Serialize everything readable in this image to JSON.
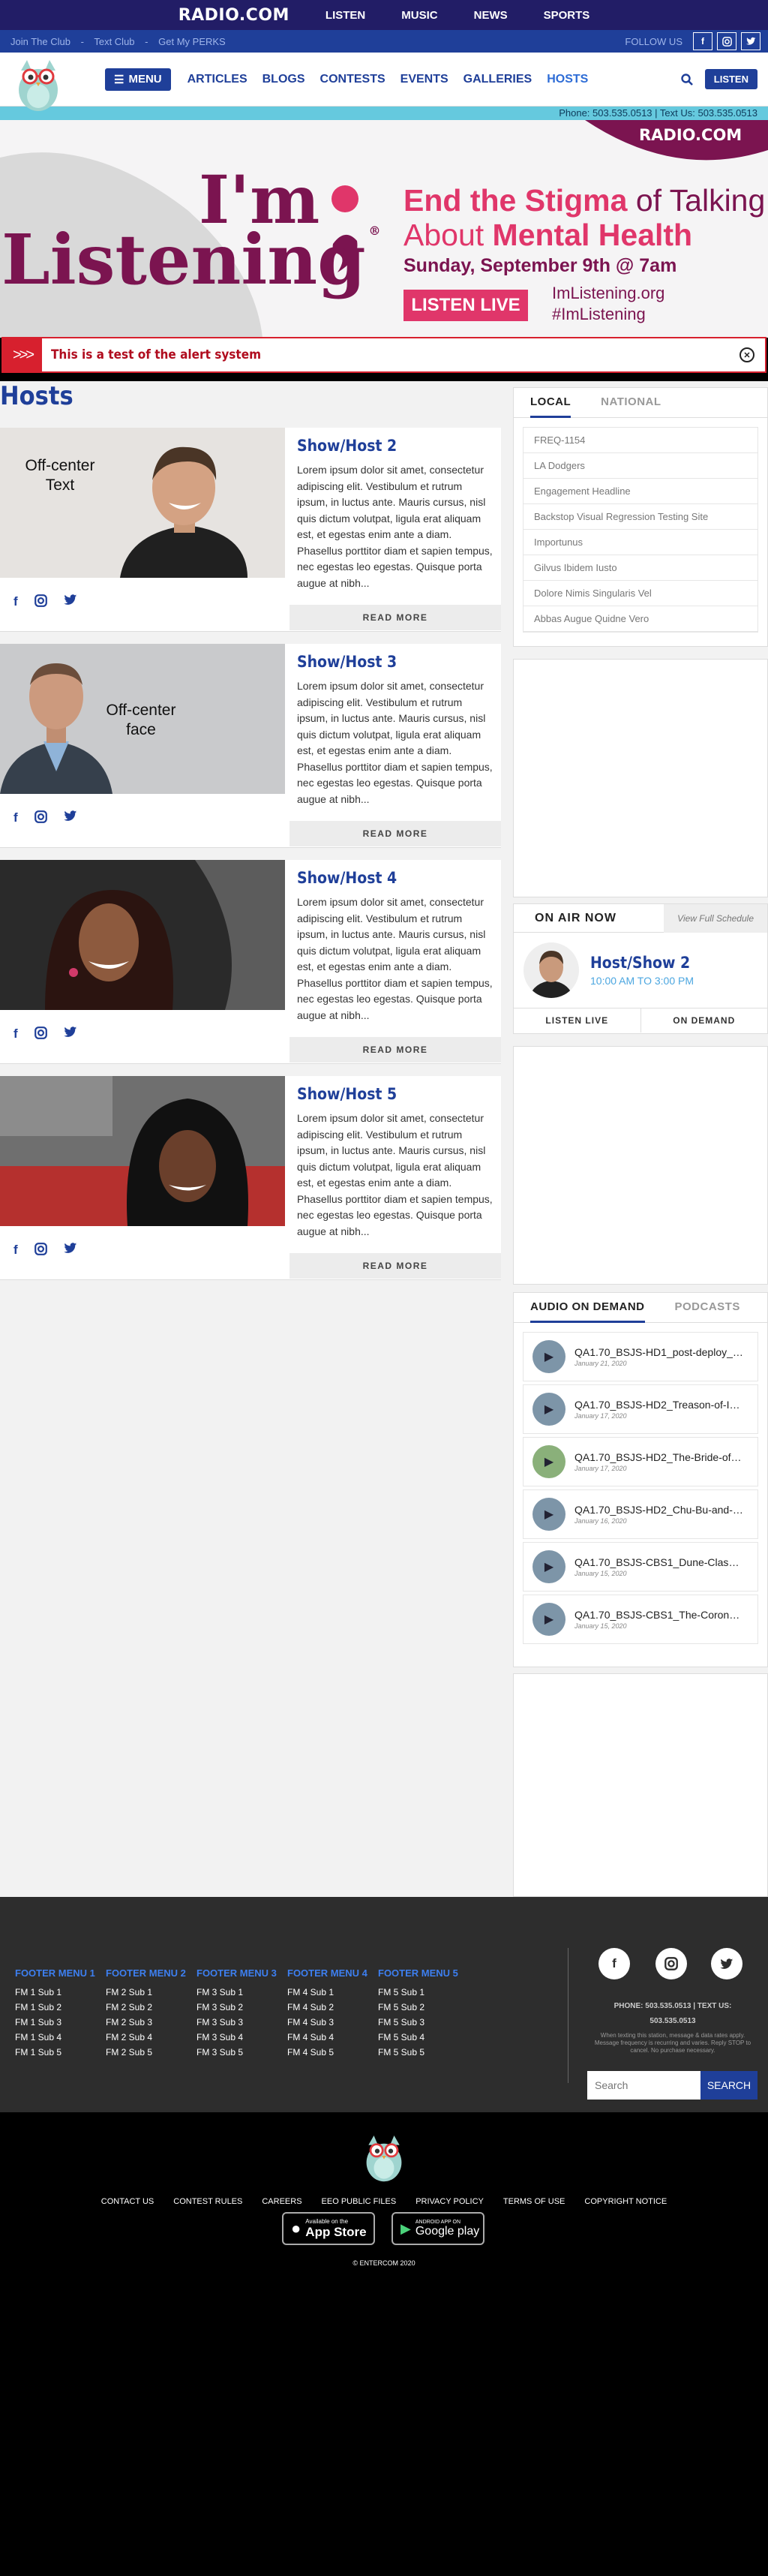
{
  "topbar": {
    "logo": "RADIO.COM",
    "nav": [
      "LISTEN",
      "MUSIC",
      "NEWS",
      "SPORTS"
    ]
  },
  "clubbar": {
    "links": [
      "Join The Club",
      "Text Club",
      "Get My PERKS"
    ],
    "separator": "-",
    "follow": "FOLLOW US"
  },
  "navbar": {
    "menu": "MENU",
    "links": [
      "ARTICLES",
      "BLOGS",
      "CONTESTS",
      "EVENTS",
      "GALLERIES",
      "HOSTS"
    ],
    "listen": "LISTEN"
  },
  "phonebar": {
    "text": "Phone: 503.535.0513 | Text Us: 503.535.0513"
  },
  "banner": {
    "logo": "RADIO.COM",
    "im": "I'm",
    "listening": "Listening",
    "reg": "®",
    "line1a": "End the Stigma",
    "line1b": " of Talking",
    "line2a": "About ",
    "line2b": "Mental Health",
    "date": "Sunday, September 9th @ 7am",
    "cta": "LISTEN LIVE",
    "url": "ImListening.org",
    "hashtag": "#ImListening"
  },
  "alert": {
    "text": "This is a test of the alert system",
    "arrows": ">>>"
  },
  "hosts": {
    "title": "Hosts",
    "read_more": "READ MORE",
    "items": [
      {
        "name": "Show/Host 2",
        "img_text": "Off-center Text",
        "desc": "Lorem ipsum dolor sit amet, consectetur adipiscing elit. Vestibulum et rutrum ipsum, in luctus ante. Mauris cursus, nisl quis dictum volutpat, ligula erat aliquam est, et egestas enim ante a diam. Phasellus porttitor diam et sapien tempus, nec egestas leo egestas. Quisque porta augue at nibh..."
      },
      {
        "name": "Show/Host 3",
        "img_text": "Off-center face",
        "desc": "Lorem ipsum dolor sit amet, consectetur adipiscing elit. Vestibulum et rutrum ipsum, in luctus ante. Mauris cursus, nisl quis dictum volutpat, ligula erat aliquam est, et egestas enim ante a diam. Phasellus porttitor diam et sapien tempus, nec egestas leo egestas. Quisque porta augue at nibh..."
      },
      {
        "name": "Show/Host 4",
        "img_text": "",
        "desc": "Lorem ipsum dolor sit amet, consectetur adipiscing elit. Vestibulum et rutrum ipsum, in luctus ante. Mauris cursus, nisl quis dictum volutpat, ligula erat aliquam est, et egestas enim ante a diam. Phasellus porttitor diam et sapien tempus, nec egestas leo egestas. Quisque porta augue at nibh..."
      },
      {
        "name": "Show/Host 5",
        "img_text": "",
        "desc": "Lorem ipsum dolor sit amet, consectetur adipiscing elit. Vestibulum et rutrum ipsum, in luctus ante. Mauris cursus, nisl quis dictum volutpat, ligula erat aliquam est, et egestas enim ante a diam. Phasellus porttitor diam et sapien tempus, nec egestas leo egestas. Quisque porta augue at nibh..."
      }
    ]
  },
  "localtabs": {
    "tabs": [
      "LOCAL",
      "NATIONAL"
    ],
    "items": [
      "FREQ-1154",
      "LA Dodgers",
      "Engagement Headline",
      "Backstop Visual Regression Testing Site",
      "Importunus",
      "Gilvus Ibidem Iusto",
      "Dolore Nimis Singularis Vel",
      "Abbas Augue Quidne Vero"
    ]
  },
  "onair": {
    "title": "ON AIR NOW",
    "schedule": "View Full Schedule",
    "show": "Host/Show 2",
    "time": "10:00 AM TO 3:00 PM",
    "listen_live": "LISTEN LIVE",
    "on_demand": "ON DEMAND"
  },
  "audio": {
    "tabs": [
      "AUDIO ON DEMAND",
      "PODCASTS"
    ],
    "items": [
      {
        "title": "QA1.70_BSJS-HD1_post-deploy_T...",
        "date": "January 21, 2020"
      },
      {
        "title": "QA1.70_BSJS-HD2_Treason-of-Ise...",
        "date": "January 17, 2020"
      },
      {
        "title": "QA1.70_BSJS-HD2_The-Bride-of-th...",
        "date": "January 17, 2020"
      },
      {
        "title": "QA1.70_BSJS-HD2_Chu-Bu-and-Sh...",
        "date": "January 16, 2020"
      },
      {
        "title": "QA1.70_BSJS-CBS1_Dune-Class-1-...",
        "date": "January 15, 2020"
      },
      {
        "title": "QA1.70_BSJS-CBS1_The-Coronati...",
        "date": "January 15, 2020"
      }
    ]
  },
  "footer": {
    "menus": [
      {
        "title": "FOOTER MENU 1",
        "items": [
          "FM 1 Sub 1",
          "FM 1 Sub 2",
          "FM 1 Sub 3",
          "FM 1 Sub 4",
          "FM 1 Sub 5"
        ]
      },
      {
        "title": "FOOTER MENU 2",
        "items": [
          "FM 2 Sub 1",
          "FM 2 Sub 2",
          "FM 2 Sub 3",
          "FM 2 Sub 4",
          "FM 2 Sub 5"
        ]
      },
      {
        "title": "FOOTER MENU 3",
        "items": [
          "FM 3 Sub 1",
          "FM 3 Sub 2",
          "FM 3 Sub 3",
          "FM 3 Sub 4",
          "FM 3 Sub 5"
        ]
      },
      {
        "title": "FOOTER MENU 4",
        "items": [
          "FM 4 Sub 1",
          "FM 4 Sub 2",
          "FM 4 Sub 3",
          "FM 4 Sub 4",
          "FM 4 Sub 5"
        ]
      },
      {
        "title": "FOOTER MENU 5",
        "items": [
          "FM 5 Sub 1",
          "FM 5 Sub 2",
          "FM 5 Sub 3",
          "FM 5 Sub 4",
          "FM 5 Sub 5"
        ]
      }
    ],
    "phone": "PHONE: 503.535.0513 | TEXT US:",
    "phone2": "503.535.0513",
    "disclaimer": "When texting this station, message & data rates apply. Message frequency is recurring and varies. Reply STOP to cancel. No purchase necessary.",
    "search_placeholder": "Search",
    "search_button": "SEARCH"
  },
  "bottom": {
    "links": [
      "CONTACT US",
      "CONTEST RULES",
      "CAREERS",
      "EEO PUBLIC FILES",
      "PRIVACY POLICY",
      "TERMS OF USE",
      "COPYRIGHT NOTICE"
    ],
    "appstore_small": "Available on the",
    "appstore": "App Store",
    "gplay_small": "ANDROID APP ON",
    "gplay": "Google play",
    "copyright": "© ENTERCOM 2020"
  },
  "colors": {
    "navy": "#221d66",
    "blue": "#1f3f99",
    "maroon": "#7b1450",
    "pink": "#e0366a",
    "alert": "#d7202e"
  }
}
